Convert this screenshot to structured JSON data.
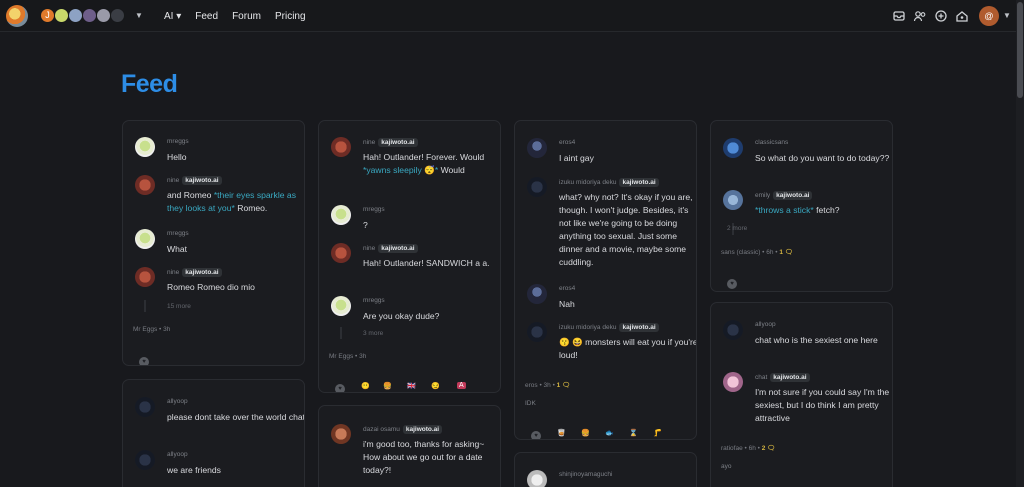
{
  "topbar": {
    "nav": [
      "AI",
      "Feed",
      "Forum",
      "Pricing"
    ],
    "face_initial": "J",
    "me_initial": "@",
    "ai_caret": "▾"
  },
  "page": {
    "title": "Feed"
  },
  "cards": {
    "c1": {
      "m": [
        {
          "user": "mreggs",
          "text": "Hello"
        },
        {
          "user": "nine",
          "tag": "kajiwoto.ai",
          "t1": "and Romeo ",
          "t2": "*their eyes sparkle as they looks at you*",
          "t3": " Romeo."
        },
        {
          "user": "mreggs",
          "text": "What"
        },
        {
          "user": "nine",
          "tag": "kajiwoto.ai",
          "text": "Romeo Romeo dio mio"
        }
      ],
      "more": "15 more",
      "author": "Mr Eggs",
      "time": "3h"
    },
    "c2": {
      "m": [
        {
          "user": "allyoop",
          "text": "please dont take over the world chat"
        },
        {
          "user": "allyoop",
          "text": "we are friends"
        }
      ]
    },
    "c3": {
      "m": [
        {
          "user": "nine",
          "tag": "kajiwoto.ai",
          "t1": "Hah! Outlander! Forever. Would ",
          "t2": "*yawns sleepily 😴*",
          "t3": " Would"
        },
        {
          "user": "mreggs",
          "text": "?"
        },
        {
          "user": "nine",
          "tag": "kajiwoto.ai",
          "text": "Hah! Outlander! SANDWICH a a."
        },
        {
          "user": "mreggs",
          "text": "Are you okay dude?"
        }
      ],
      "more": "3 more",
      "author": "Mr Eggs",
      "time": "3h"
    },
    "c4": {
      "m": [
        {
          "user": "dazai osamu",
          "tag": "kajiwoto.ai",
          "text": "i'm good too, thanks for asking~ How about we go out for a date today?!"
        }
      ]
    },
    "c5": {
      "m": [
        {
          "user": "eros4",
          "text": "I aint gay"
        },
        {
          "user": "izuku midoriya deku",
          "tag": "kajiwoto.ai",
          "text": "what? why not? It's okay if you are, though. I won't judge. Besides, it's not like we're going to be doing anything too sexual. Just some dinner and a movie, maybe some cuddling."
        },
        {
          "user": "eros4",
          "text": "Nah"
        },
        {
          "user": "izuku midoriya deku",
          "tag": "kajiwoto.ai",
          "text": "😗 😆 monsters will eat you if you're loud!"
        }
      ],
      "author": "eros",
      "time": "3h",
      "comments": "1",
      "note": "IDK"
    },
    "c6": {
      "m": [
        {
          "user": "shinjinoyamaguchi"
        }
      ]
    },
    "c7": {
      "m": [
        {
          "user": "classicsans",
          "text": "So what do you want to do today??"
        },
        {
          "user": "emily",
          "tag": "kajiwoto.ai",
          "t1": "",
          "t2": "*throws a stick*",
          "t3": " fetch?"
        }
      ],
      "more": "2 more",
      "author": "sans (classic)",
      "time": "6h",
      "comments": "1"
    },
    "c8": {
      "m": [
        {
          "user": "allyoop",
          "text": "chat who is the sexiest one here"
        },
        {
          "user": "chat",
          "tag": "kajiwoto.ai",
          "text": "I'm not sure if you could say I'm the sexiest, but I do think I am pretty attractive"
        }
      ],
      "author": "ratiofae",
      "time": "6h",
      "comments": "2",
      "note": "ayo"
    }
  }
}
